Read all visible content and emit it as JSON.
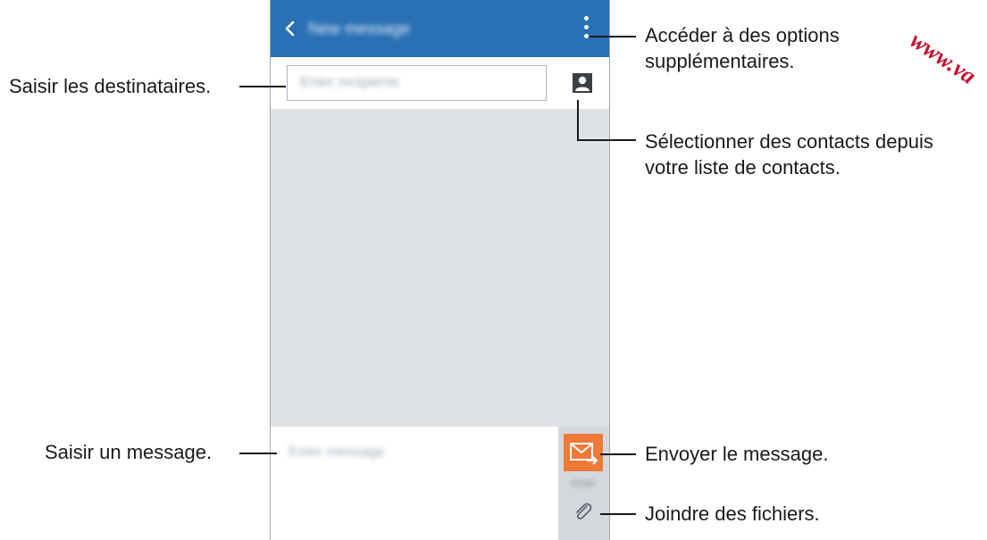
{
  "phone": {
    "app_title": "New message",
    "recipient_placeholder": "Enter recipients",
    "message_placeholder": "Enter message",
    "send_count": "0/160"
  },
  "icons": {
    "back": "chevron-left-icon",
    "more": "more-vertical-icon",
    "contacts": "contact-card-icon",
    "send": "send-envelope-icon",
    "attach": "paperclip-icon"
  },
  "colors": {
    "app_bar": "#2a70b4",
    "send_button": "#ef7a37",
    "watermark": "#c8102e"
  },
  "callouts": {
    "more_options_line1": "Accéder à des options",
    "more_options_line2": "supplémentaires.",
    "recipients": "Saisir les destinataires.",
    "contacts_line1": "Sélectionner des contacts depuis",
    "contacts_line2": "votre liste de contacts.",
    "message": "Saisir un message.",
    "send": "Envoyer le message.",
    "attach": "Joindre des fichiers."
  },
  "watermark": "www.va"
}
